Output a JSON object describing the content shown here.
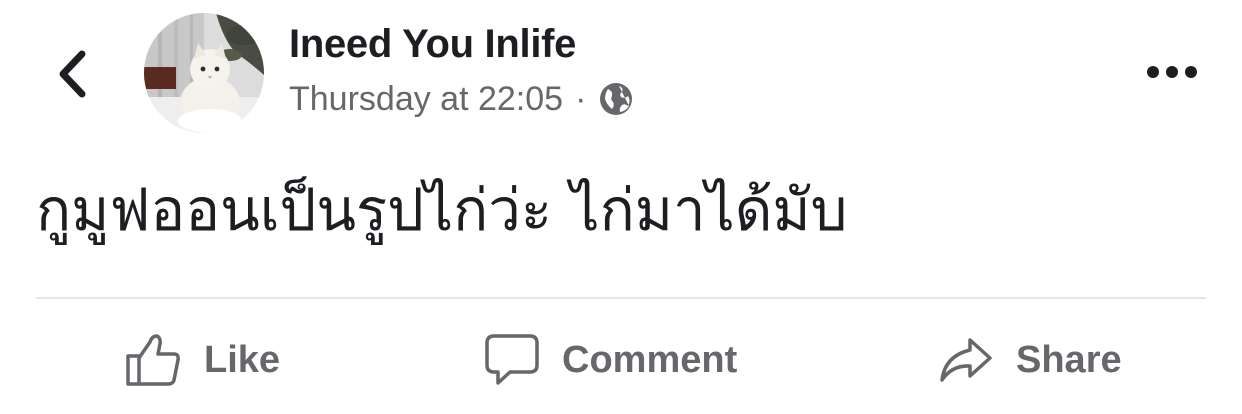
{
  "post": {
    "author": "Ineed You Inlife",
    "timestamp": "Thursday at 22:05",
    "separator": "·",
    "audience_icon": "globe-icon",
    "text": "กูมูฟออนเป็นรูปไก่ว่ะ ไก่มาได้มับ"
  },
  "actions": {
    "like_label": "Like",
    "comment_label": "Comment",
    "share_label": "Share"
  },
  "icons": {
    "back": "chevron-left-icon",
    "more": "more-dots-icon",
    "like": "thumbs-up-icon",
    "comment": "speech-bubble-icon",
    "share": "share-arrow-icon"
  },
  "colors": {
    "text_primary": "#1c1e21",
    "text_secondary": "#65676b",
    "divider": "#e4e6eb",
    "background": "#ffffff"
  }
}
